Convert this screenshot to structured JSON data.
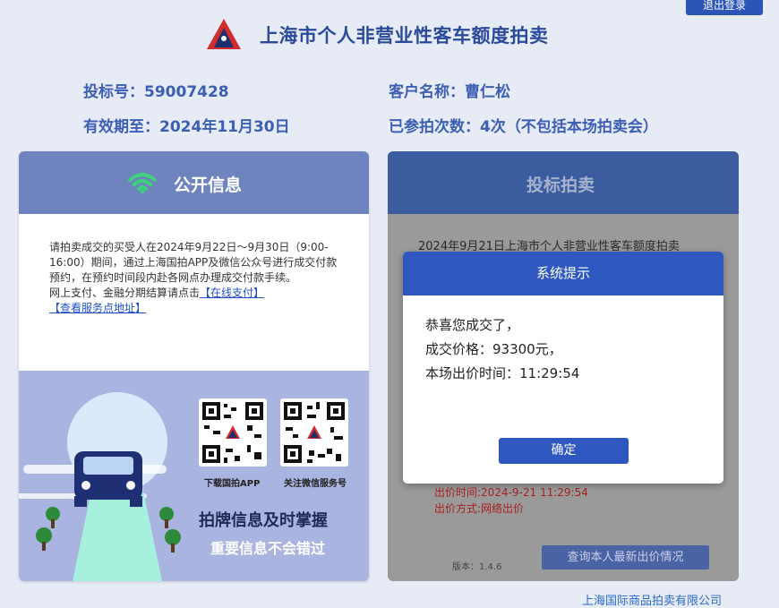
{
  "header": {
    "logout_label": "退出登录",
    "site_title": "上海市个人非营业性客车额度拍卖"
  },
  "bidder_info": {
    "bid_number": "投标号：59007428",
    "customer_name": "客户名称：曹仁松",
    "valid_until": "有效期至：2024年11月30日",
    "participation_count": "已参拍次数：4次（不包括本场拍卖会）"
  },
  "public_info": {
    "title": "公开信息",
    "notice_text": "请拍卖成交的买受人在2024年9月22日～9月30日（9:00-16:00）期间，通过上海国拍APP及微信公众号进行成交付款预约，在预约时间段内赴各网点办理成交付款手续。",
    "notice_text2": "网上支付、金融分期结算请点击",
    "online_pay_link": "【在线支付】",
    "service_points_link": "【查看服务点地址】",
    "qr_app_label": "下载国拍APP",
    "qr_wechat_label": "关注微信服务号",
    "slogan_main": "拍牌信息及时掌握",
    "slogan_sub": "重要信息不会错过"
  },
  "bidding": {
    "title": "投标拍卖",
    "auction_heading": "2024年9月21日上海市个人非营业性客车额度拍卖",
    "bid_time_line": "出价时间:2024-9-21 11:29:54",
    "bid_method_line": "出价方式:网络出价",
    "version": "版本：1.4.6",
    "query_button": "查询本人最新出价情况"
  },
  "modal": {
    "title": "系统提示",
    "line1": "恭喜您成交了，",
    "line2": "成交价格：93300元，",
    "line3": "本场出价时间：11:29:54",
    "ok_button": "确定"
  },
  "footer": {
    "company": "上海国际商品拍卖有限公司"
  },
  "colors": {
    "accent": "#2e57bf",
    "left_header": "#6f83bf",
    "right_header": "#3b5c9f",
    "page_bg": "#e6ebf5",
    "promo_bg": "#a9b4e0"
  },
  "icons": [
    "logo-triangle",
    "wifi-icon",
    "car-illustration",
    "qr-code-icon"
  ]
}
